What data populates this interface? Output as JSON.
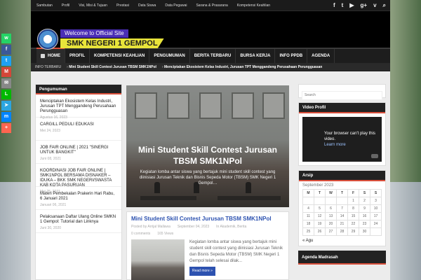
{
  "topbar": {
    "links": [
      "Sambutan",
      "Profil",
      "Visi, Misi & Tujuan",
      "Prestasi",
      "Data Siswa",
      "Data Pegawai",
      "Sarana & Prasarana",
      "Kompetensi Keahlian"
    ],
    "social": [
      {
        "name": "facebook-icon",
        "glyph": "f"
      },
      {
        "name": "twitter-icon",
        "glyph": "t"
      },
      {
        "name": "youtube-icon",
        "glyph": "▶"
      },
      {
        "name": "google-plus-icon",
        "glyph": "g+"
      },
      {
        "name": "vimeo-icon",
        "glyph": "v"
      },
      {
        "name": "search-icon",
        "glyph": "⌕"
      }
    ]
  },
  "header": {
    "welcome": "Welcome to Official Site",
    "school_name": "SMK NEGERI 1 GEMPOL"
  },
  "nav": {
    "items": [
      "HOME",
      "PROFIL",
      "KOMPETENSI KEAHLIAN",
      "PENGUMUMAN",
      "BERITA TERBARU",
      "BURSA KERJA",
      "INFO PPDB",
      "AGENDA"
    ]
  },
  "ticker": {
    "label": "INFO TERBARU",
    "items": [
      "Mini Student Skill Contest Jurusan TBSM SMK1NPol",
      "Menciptakan Ekosistem Kelas Industri, Jurusan TPT Menggandeng Perusahaan Perungguasan"
    ]
  },
  "left_panel": {
    "title": "Pengumuman",
    "items": [
      {
        "title": "Menciptakan Ekosistem Kelas Industri, Jurusan TPT Menggandeng Perusahaan Perungguasan",
        "date": "Agustus 16, 2023"
      },
      {
        "title": "CARGILL PEDULI EDUKASI",
        "date": "Mei 24, 2023"
      },
      {
        "title": "JOB FAIR ONLINE | 2021 \"SINERGI UNTUK BANGKIT\"",
        "date": "Juni 08, 2021"
      },
      {
        "title": "KOORDINASI JOB FAIR ONLINE | SMK1NPOL BERSAMA DISNAKER – IDUKA – BKK SMK NEGERI/SWASTA KAB KOTA PASURUAN",
        "date": "Mei 25, 2021"
      },
      {
        "title": "Materi Pembekalan Prakerin Hari Rabu, 6 Januari 2021",
        "date": "Januari 06, 2021"
      },
      {
        "title": "Pelaksanaan Daftar Ulang Online SMKN 1 Gempol: Tutorial dan Linknya",
        "date": "Juni 30, 2020"
      }
    ]
  },
  "hero": {
    "title": "Mini Student Skill Contest Jurusan TBSM SMK1NPol",
    "excerpt": "Kegiatan lomba antar siswa yang bertajuk mini student skill contest yang diinisiasi Jurusan Teknik dan Bisnis Sepeda Motor (TBSM) SMK Negeri 1 Gempol…"
  },
  "article": {
    "title": "Mini Student Skill Contest Jurusan TBSM SMK1NPol",
    "author": "Posted by Arrijal Mallawa",
    "date": "September 04, 2023",
    "category": "In Akademik, Berita",
    "comments": "0 comments",
    "views": "165 Views",
    "excerpt": "Kegiatan lomba antar siswa yang bertajuk mini student skill contest yang diinisiasi Jurusan Teknik dan Bisnis Sepeda Motor (TBSM) SMK Negeri 1 Gempol telah selesai dilak...",
    "read_more": "Read more »"
  },
  "sidebar": {
    "search_placeholder": "Search",
    "video_title": "Video Profil",
    "video_msg": "Your browser can't play this video.",
    "video_link": "Learn more",
    "archive_title": "Arsip",
    "calendar_month": "September 2023",
    "calendar_days": [
      "M",
      "T",
      "W",
      "T",
      "F",
      "S",
      "S"
    ],
    "calendar_weeks": [
      [
        "",
        "",
        "",
        "",
        "1",
        "2",
        "3"
      ],
      [
        "4",
        "5",
        "6",
        "7",
        "8",
        "9",
        "10"
      ],
      [
        "11",
        "12",
        "13",
        "14",
        "15",
        "16",
        "17"
      ],
      [
        "18",
        "19",
        "20",
        "21",
        "22",
        "23",
        "24"
      ],
      [
        "25",
        "26",
        "27",
        "28",
        "29",
        "30",
        ""
      ]
    ],
    "prev_label": "« Agu",
    "last_block_title": "Agenda Madrasah"
  },
  "share_bar": [
    {
      "name": "whatsapp-share-icon",
      "color": "#25d366",
      "glyph": "w"
    },
    {
      "name": "facebook-share-icon",
      "color": "#3b5998",
      "glyph": "f"
    },
    {
      "name": "twitter-share-icon",
      "color": "#1da1f2",
      "glyph": "t"
    },
    {
      "name": "gmail-share-icon",
      "color": "#d44638",
      "glyph": "M"
    },
    {
      "name": "email-share-icon",
      "color": "#888",
      "glyph": "✉"
    },
    {
      "name": "line-share-icon",
      "color": "#00b900",
      "glyph": "L"
    },
    {
      "name": "telegram-share-icon",
      "color": "#2ca5e0",
      "glyph": "➤"
    },
    {
      "name": "messenger-share-icon",
      "color": "#0084ff",
      "glyph": "m"
    },
    {
      "name": "more-share-icon",
      "color": "#ff6550",
      "glyph": "+"
    }
  ]
}
